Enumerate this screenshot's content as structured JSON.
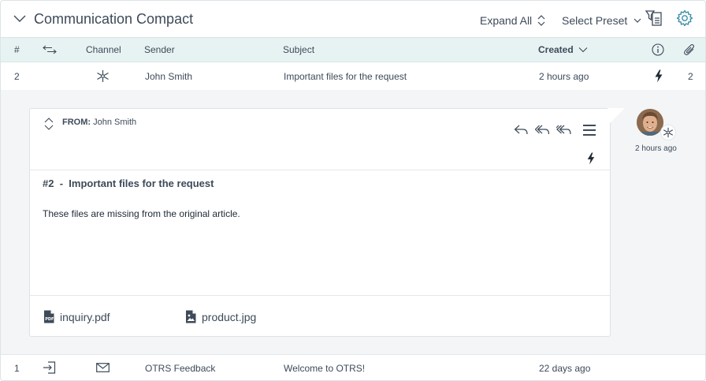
{
  "header": {
    "title": "Communication Compact",
    "expand_all": "Expand All",
    "select_preset": "Select Preset"
  },
  "columns": {
    "number": "#",
    "channel": "Channel",
    "sender": "Sender",
    "subject": "Subject",
    "created": "Created"
  },
  "rows": [
    {
      "number": "2",
      "sender": "John Smith",
      "subject": "Important files for the request",
      "created": "2 hours ago",
      "attachments": "2"
    },
    {
      "number": "1",
      "sender": "OTRS Feedback",
      "subject": "Welcome to OTRS!",
      "created": "22 days ago"
    }
  ],
  "article": {
    "from_label": "FROM:",
    "from_name": "John Smith",
    "number": "#2",
    "separator": "-",
    "subject": "Important files for the request",
    "body": "These files are missing from the original article.",
    "attachments": [
      {
        "name": "inquiry.pdf",
        "icon": "pdf-file-icon"
      },
      {
        "name": "product.jpg",
        "icon": "image-file-icon"
      }
    ],
    "avatar_time": "2 hours ago"
  },
  "colors": {
    "header_bg": "#e7f3f2",
    "accent": "#3a8fa8",
    "text": "#3d4a59",
    "expanded_bg": "#f3f5f6"
  }
}
